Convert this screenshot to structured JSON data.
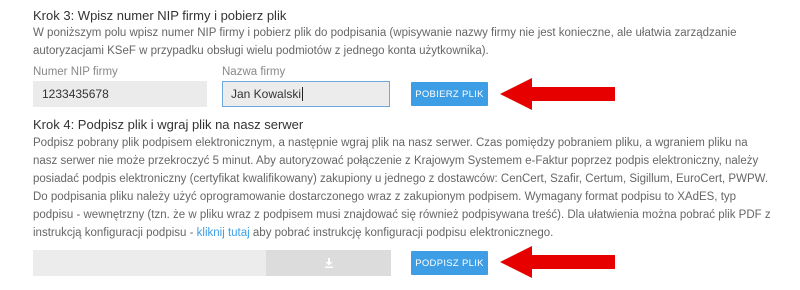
{
  "step3": {
    "title": "Krok 3: Wpisz numer NIP firmy i pobierz plik",
    "description": "W poniższym polu wpisz numer NIP firmy i pobierz plik do podpisania (wpisywanie nazwy firmy nie jest konieczne, ale ułatwia zarządzanie autoryzacjami KSeF w przypadku obsługi wielu podmiotów z jednego konta użytkownika).",
    "nip_label": "Numer NIP firmy",
    "nip_value": "1233435678",
    "name_label": "Nazwa firmy",
    "name_value": "Jan Kowalski",
    "download_button": "POBIERZ PLIK"
  },
  "step4": {
    "title": "Krok 4: Podpisz plik i wgraj plik na nasz serwer",
    "description_before_link": "Podpisz pobrany plik podpisem elektronicznym, a następnie wgraj plik na nasz serwer. Czas pomiędzy pobraniem pliku, a wgraniem pliku na nasz serwer nie może przekroczyć 5 minut. Aby autoryzować połączenie z Krajowym Systemem e-Faktur poprzez podpis elektroniczny, należy posiadać podpis elektroniczny (certyfikat kwalifikowany) zakupiony u jednego z dostawców: CenCert, Szafir, Certum, Sigillum, EuroCert, PWPW. Do podpisania pliku należy użyć oprogramowanie dostarczonego wraz z zakupionym podpisem. Wymagany format podpisu to XAdES, typ podpisu - wewnętrzny (tzn. że w pliku wraz z podpisem musi znajdować się również podpisywana treść). Dla ułatwienia można pobrać plik PDF z instrukcją konfiguracji podpisu - ",
    "link_text": "kliknij tutaj",
    "description_after_link": " aby pobrać instrukcję konfiguracji podpisu elektronicznego.",
    "sign_button": "PODPISZ PLIK"
  },
  "icons": {
    "upload": "download-icon",
    "arrow": "red-arrow-icon"
  },
  "colors": {
    "button": "#3d9ee6",
    "arrow": "#e60000",
    "link": "#3d9ee6"
  }
}
